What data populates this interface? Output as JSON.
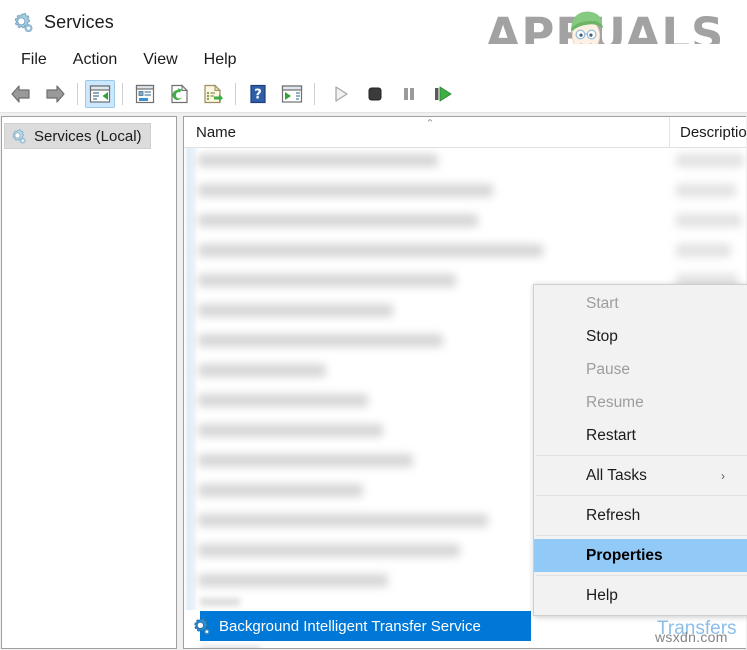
{
  "window": {
    "title": "Services",
    "icon": "services-gear-icon"
  },
  "watermark": {
    "brand": "APPUALS",
    "site": "wsxdn.com",
    "ghost_text": "Transfers"
  },
  "menubar": {
    "items": [
      {
        "label": "File",
        "name": "menu-file"
      },
      {
        "label": "Action",
        "name": "menu-action"
      },
      {
        "label": "View",
        "name": "menu-view"
      },
      {
        "label": "Help",
        "name": "menu-help"
      }
    ]
  },
  "toolbar": {
    "buttons": [
      {
        "name": "back-icon",
        "label": "Back",
        "enabled": true
      },
      {
        "name": "forward-icon",
        "label": "Forward",
        "enabled": true
      },
      {
        "name": "show-hide-console-tree-icon",
        "label": "Show/Hide Console Tree",
        "enabled": true,
        "active": true
      },
      {
        "name": "properties-icon",
        "label": "Properties",
        "enabled": true
      },
      {
        "name": "refresh-icon",
        "label": "Refresh",
        "enabled": true
      },
      {
        "name": "export-list-icon",
        "label": "Export List",
        "enabled": true
      },
      {
        "name": "help-icon",
        "label": "Help",
        "enabled": true
      },
      {
        "name": "show-hide-action-pane-icon",
        "label": "Show/Hide Action Pane",
        "enabled": true
      },
      {
        "name": "start-service-icon",
        "label": "Start Service",
        "enabled": false
      },
      {
        "name": "stop-service-icon",
        "label": "Stop Service",
        "enabled": true
      },
      {
        "name": "pause-service-icon",
        "label": "Pause Service",
        "enabled": false
      },
      {
        "name": "restart-service-icon",
        "label": "Restart Service",
        "enabled": true
      }
    ]
  },
  "tree": {
    "root_label": "Services (Local)"
  },
  "list": {
    "columns": [
      {
        "key": "name",
        "label": "Name",
        "sorted": "ascending"
      },
      {
        "key": "description",
        "label": "Descriptio"
      }
    ],
    "selected_item": {
      "label": "Background Intelligent Transfer Service",
      "icon": "service-gear-icon"
    },
    "obscured_row_count": 15
  },
  "context_menu": {
    "items": [
      {
        "label": "Start",
        "enabled": false,
        "selected": false,
        "submenu": false
      },
      {
        "label": "Stop",
        "enabled": true,
        "selected": false,
        "submenu": false
      },
      {
        "label": "Pause",
        "enabled": false,
        "selected": false,
        "submenu": false
      },
      {
        "label": "Resume",
        "enabled": false,
        "selected": false,
        "submenu": false
      },
      {
        "label": "Restart",
        "enabled": true,
        "selected": false,
        "submenu": false
      },
      {
        "separator": true
      },
      {
        "label": "All Tasks",
        "enabled": true,
        "selected": false,
        "submenu": true
      },
      {
        "separator": true
      },
      {
        "label": "Refresh",
        "enabled": true,
        "selected": false,
        "submenu": false
      },
      {
        "separator": true
      },
      {
        "label": "Properties",
        "enabled": true,
        "selected": true,
        "submenu": false
      },
      {
        "separator": true
      },
      {
        "label": "Help",
        "enabled": true,
        "selected": false,
        "submenu": false
      }
    ],
    "submenu_arrow": "›"
  },
  "colors": {
    "selection_blue": "#0078d7",
    "menu_highlight": "#91c9f7",
    "toolbar_active": "#cce8ff",
    "window_bg": "#ffffff",
    "pane_border": "#a0a0a0"
  }
}
